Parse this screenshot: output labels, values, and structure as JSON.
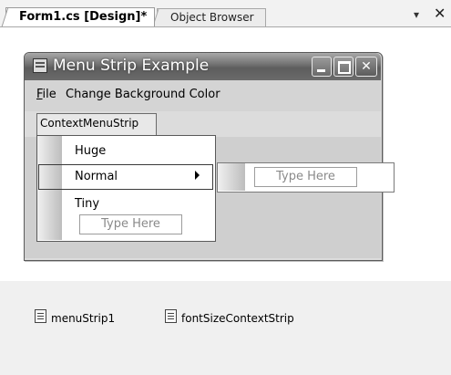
{
  "document_tabs": [
    {
      "label": "Form1.cs [Design]*",
      "active": true
    },
    {
      "label": "Object Browser",
      "active": false
    }
  ],
  "tab_controls": {
    "pin_icon": "down-arrow-icon",
    "close_icon": "close-icon",
    "pin_glyph": "▾",
    "close_glyph": "✕"
  },
  "form": {
    "title": "Menu Strip Example",
    "title_icon": "form-icon"
  },
  "menu_strip": {
    "file_label": "File",
    "file_rest": "ile",
    "file_mnemonic": "F",
    "change_bg_label": "Change Background Color"
  },
  "context_menu_strip": {
    "label": "ContextMenuStrip",
    "items": [
      "Huge",
      "Normal",
      "Tiny"
    ],
    "type_here": "Type Here",
    "submenu_type_here": "Type Here"
  },
  "component_tray": {
    "items": [
      {
        "label": "menuStrip1",
        "icon": "menu-strip-icon"
      },
      {
        "label": "fontSizeContextStrip",
        "icon": "context-menu-strip-icon"
      }
    ]
  },
  "colors": {
    "title_bar": "#6a6a6a",
    "tray": "#f0f0f0",
    "client": "#cfcfcf"
  }
}
